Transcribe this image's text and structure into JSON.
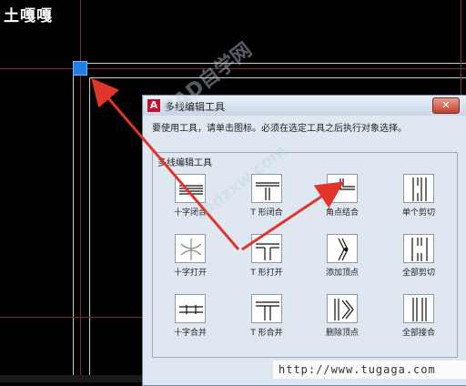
{
  "brand": {
    "text": "土嘎嘎"
  },
  "dialog": {
    "title": "多线编辑工具",
    "close_label": "✕",
    "instruction": "要使用工具，请单击图标。必须在选定工具之后执行对象选择。",
    "group_label": "多线编辑工具",
    "tools": [
      {
        "icon": "closed-cross-icon",
        "label": "十字闭合"
      },
      {
        "icon": "closed-tee-icon",
        "label": "T 形闭合"
      },
      {
        "icon": "corner-joint-icon",
        "label": "角点结合"
      },
      {
        "icon": "cut-single-icon",
        "label": "单个剪切"
      },
      {
        "icon": "open-cross-icon",
        "label": "十字打开"
      },
      {
        "icon": "open-tee-icon",
        "label": "T 形打开"
      },
      {
        "icon": "add-vertex-icon",
        "label": "添加顶点"
      },
      {
        "icon": "cut-all-icon",
        "label": "全部剪切"
      },
      {
        "icon": "merged-cross-icon",
        "label": "十字合并"
      },
      {
        "icon": "merged-tee-icon",
        "label": "T 形合并"
      },
      {
        "icon": "delete-vertex-icon",
        "label": "删除顶点"
      },
      {
        "icon": "weld-all-icon",
        "label": "全部接合"
      }
    ]
  },
  "watermark": {
    "text": "CAD自学网",
    "domain": "cadzxw.com"
  },
  "url_banner": {
    "text": "http://www.tugaga.com"
  },
  "colors": {
    "grip": "#1e7fe6",
    "arrow": "#e0352b",
    "crosshair": "#8a3030",
    "dialog_bg": "#dfe7f1"
  }
}
